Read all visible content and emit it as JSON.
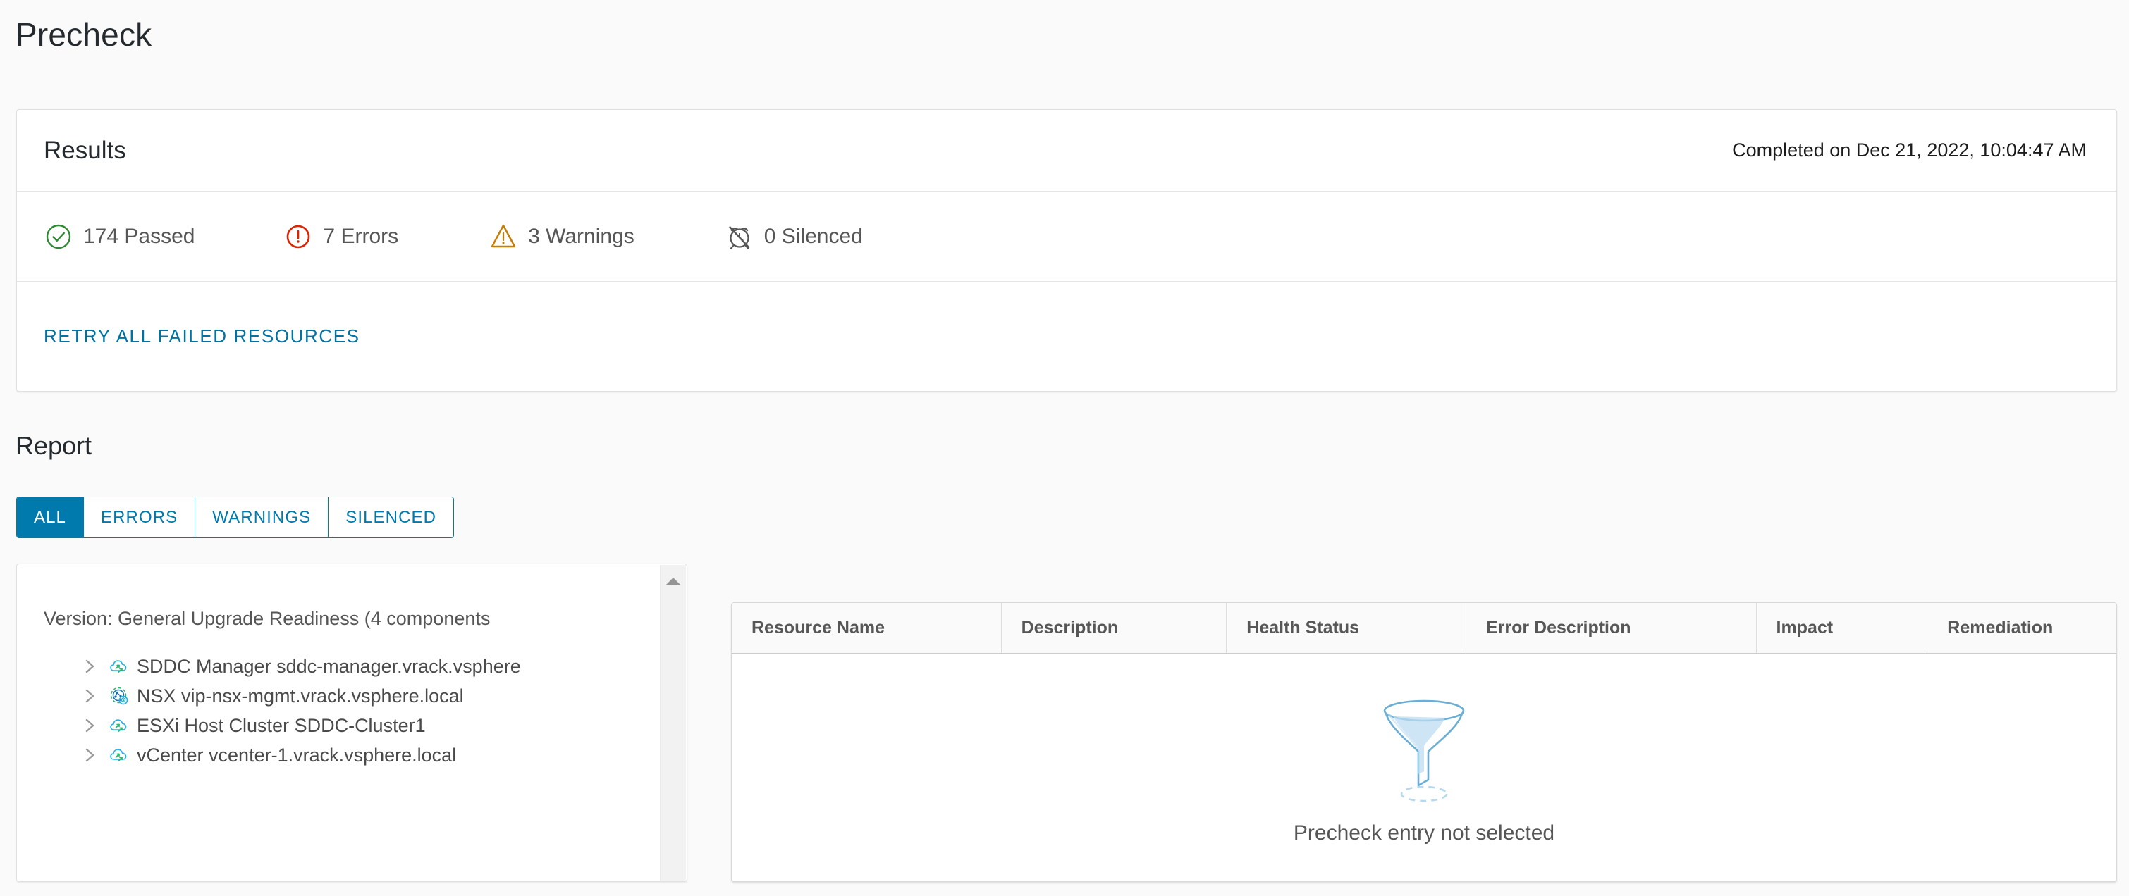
{
  "page": {
    "title": "Precheck"
  },
  "results": {
    "heading": "Results",
    "completed_on": "Completed on Dec 21, 2022, 10:04:47 AM",
    "stats": [
      {
        "label": "174 Passed",
        "icon": "check-circle-icon",
        "color": "#2f8a33"
      },
      {
        "label": "7 Errors",
        "icon": "error-circle-icon",
        "color": "#e02200"
      },
      {
        "label": "3 Warnings",
        "icon": "warning-triangle-icon",
        "color": "#c47d00"
      },
      {
        "label": "0 Silenced",
        "icon": "alarm-off-icon",
        "color": "#565656"
      }
    ],
    "retry_label": "RETRY ALL FAILED RESOURCES"
  },
  "report": {
    "heading": "Report",
    "tabs": [
      {
        "label": "ALL",
        "active": true
      },
      {
        "label": "ERRORS",
        "active": false
      },
      {
        "label": "WARNINGS",
        "active": false
      },
      {
        "label": "SILENCED",
        "active": false
      }
    ]
  },
  "tree": {
    "root_label": "Version: General Upgrade Readiness (4 components",
    "items": [
      {
        "label": "SDDC Manager sddc-manager.vrack.vsphere",
        "icon": "cloud-upgrade-icon"
      },
      {
        "label": "NSX vip-nsx-mgmt.vrack.vsphere.local",
        "icon": "nsx-network-icon"
      },
      {
        "label": "ESXi Host Cluster SDDC-Cluster1",
        "icon": "cloud-upgrade-icon"
      },
      {
        "label": "vCenter vcenter-1.vrack.vsphere.local",
        "icon": "cloud-upgrade-icon"
      }
    ]
  },
  "table": {
    "columns": [
      "Resource Name",
      "Description",
      "Health Status",
      "Error Description",
      "Impact",
      "Remediation"
    ],
    "rows": [],
    "empty_message": "Precheck entry not selected",
    "empty_icon": "funnel-icon"
  },
  "colors": {
    "accent": "#0079ad",
    "link": "#0072a3",
    "pass": "#2f8a33",
    "error": "#e02200",
    "warning": "#c47d00",
    "muted": "#565656",
    "page_bg": "#fafafa"
  }
}
